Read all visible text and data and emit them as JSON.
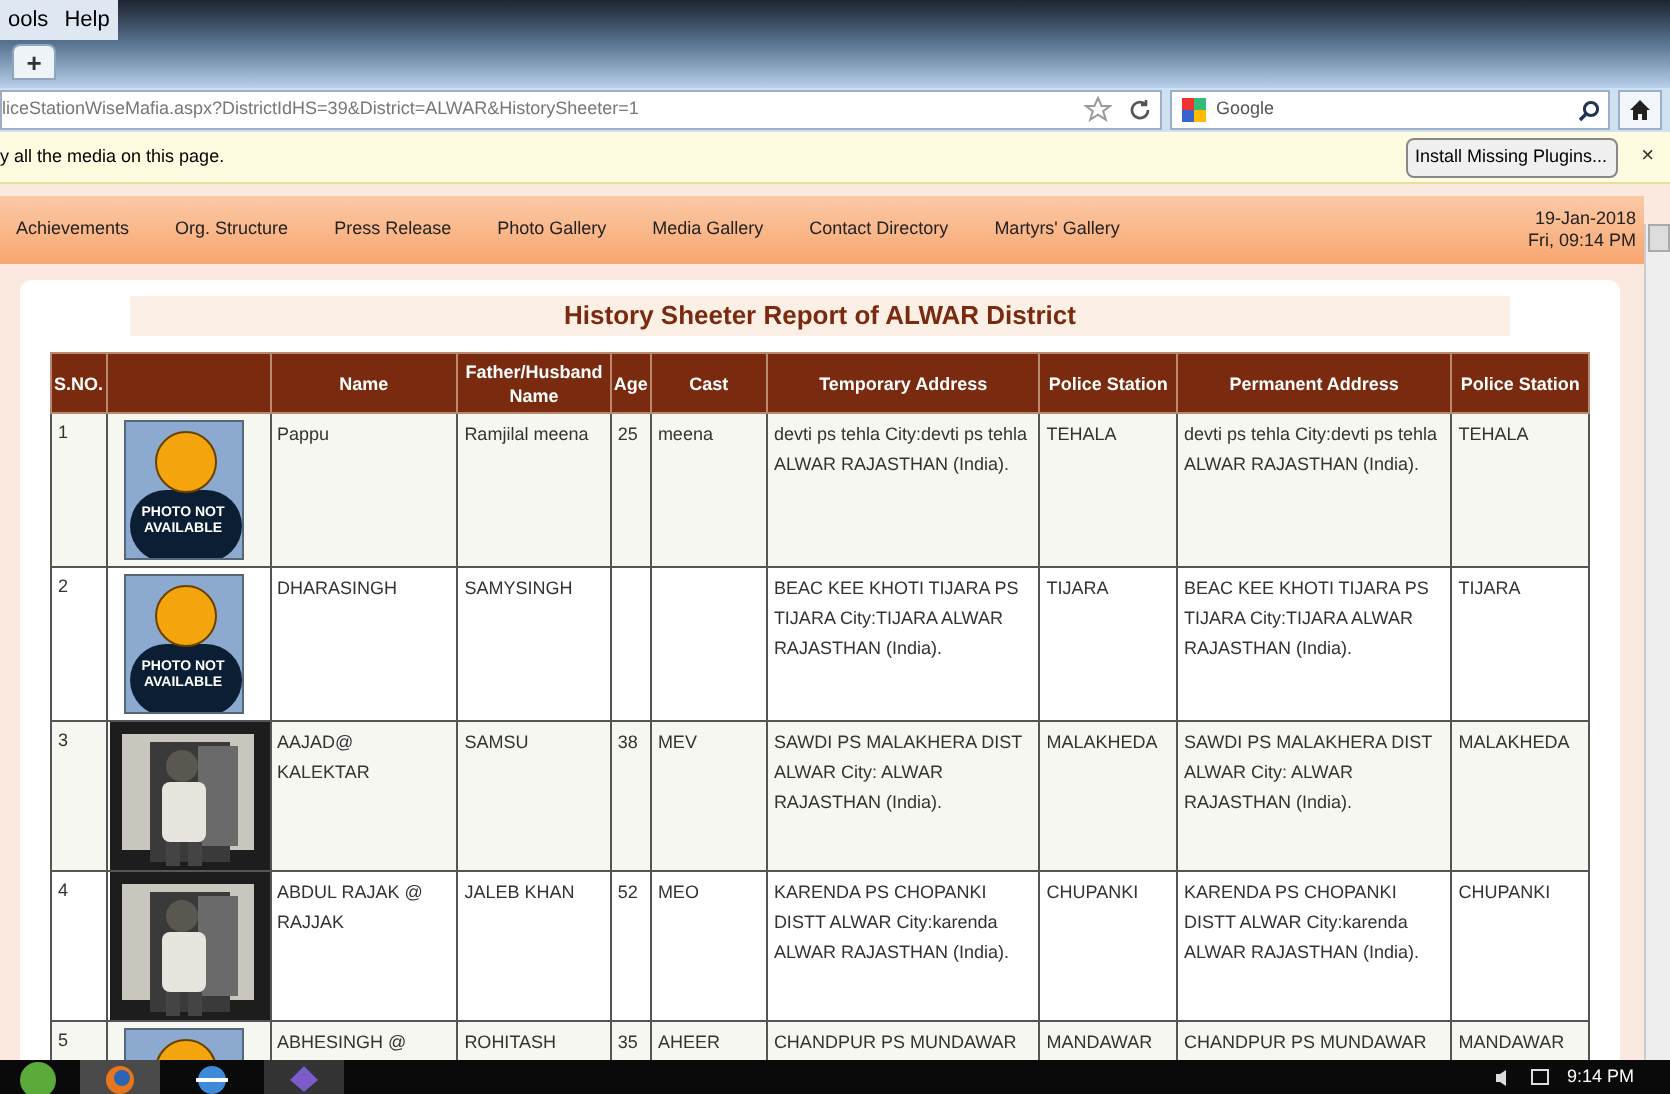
{
  "menu": [
    "ools",
    "Help"
  ],
  "tabs": {
    "new_tab": "+"
  },
  "address_bar": {
    "url": "liceStationWiseMafia.aspx?DistrictIdHS=39&District=ALWAR&HistorySheeter=1"
  },
  "search": {
    "engine": "Google"
  },
  "notification": {
    "text": "y all the media on this page.",
    "button": "Install Missing Plugins...",
    "close": "×"
  },
  "nav": [
    "Achievements",
    "Org. Structure",
    "Press Release",
    "Photo Gallery",
    "Media Gallery",
    "Contact Directory",
    "Martyrs' Gallery"
  ],
  "date": "19-Jan-2018",
  "time": "Fri, 09:14 PM",
  "report": {
    "title": "History Sheeter Report of ALWAR District",
    "columns": [
      "S.NO.",
      "",
      "Name",
      "Father/Husband Name",
      "Age",
      "Cast",
      "Temporary Address",
      "Police Station",
      "Permanent Address",
      "Police Station"
    ],
    "rows": [
      {
        "sno": "1",
        "photo": {
          "kind": "placeholder",
          "caption": "PHOTO NOT AVAILABLE"
        },
        "name": "Pappu",
        "father": "Ramjilal meena",
        "age": "25",
        "cast": "meena",
        "temp_address": "devti ps tehla City:devti ps tehla ALWAR RAJASTHAN (India).",
        "temp_station": "TEHALA",
        "perm_address": "devti ps tehla City:devti ps tehla ALWAR RAJASTHAN (India).",
        "perm_station": "TEHALA"
      },
      {
        "sno": "2",
        "photo": {
          "kind": "placeholder",
          "caption": "PHOTO NOT AVAILABLE"
        },
        "name": "DHARASINGH",
        "father": "SAMYSINGH",
        "temp_address": "BEAC KEE KHOTI TIJARA PS TIJARA City:TIJARA ALWAR RAJASTHAN (India).",
        "temp_station": "TIJARA",
        "perm_address": "BEAC KEE KHOTI TIJARA PS TIJARA City:TIJARA ALWAR RAJASTHAN (India).",
        "perm_station": "TIJARA"
      },
      {
        "sno": "3",
        "name": "AAJAD@ KALEKTAR",
        "father": "SAMSU",
        "age": "38",
        "cast": "MEV",
        "temp_address": "SAWDI PS MALAKHERA DIST ALWAR City: ALWAR RAJASTHAN (India).",
        "temp_station": "MALAKHEDA",
        "perm_address": "SAWDI PS MALAKHERA DIST ALWAR City: ALWAR RAJASTHAN (India).",
        "perm_station": "MALAKHEDA"
      },
      {
        "sno": "4",
        "name": "ABDUL RAJAK @ RAJJAK",
        "father": "JALEB KHAN",
        "age": "52",
        "cast": "MEO",
        "temp_address": "KARENDA PS CHOPANKI DISTT ALWAR City:karenda ALWAR RAJASTHAN (India).",
        "temp_station": "CHUPANKI",
        "perm_address": "KARENDA PS CHOPANKI DISTT ALWAR City:karenda ALWAR RAJASTHAN (India).",
        "perm_station": "CHUPANKI"
      },
      {
        "sno": "5",
        "photo": {
          "kind": "placeholder"
        },
        "name": "ABHESINGH @",
        "father": "ROHITASH",
        "age": "35",
        "cast": "AHEER",
        "temp_address": "CHANDPUR PS MUNDAWAR",
        "temp_station": "MANDAWAR",
        "perm_address": "CHANDPUR PS MUNDAWAR",
        "perm_station": "MANDAWAR"
      }
    ]
  },
  "taskbar": {
    "clock": "9:14 PM"
  }
}
